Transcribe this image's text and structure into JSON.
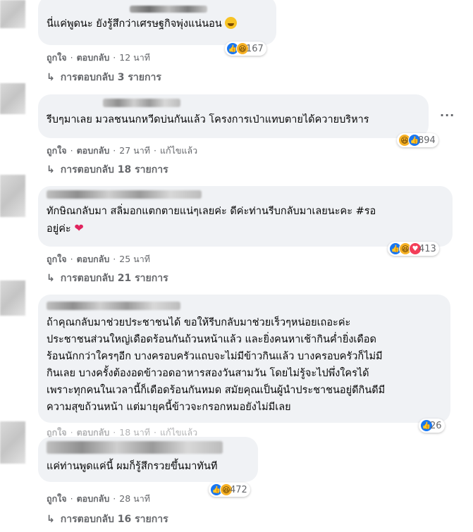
{
  "comments": [
    {
      "text": "นี่แค่พูดนะ ยังรู้สึกว่าเศรษฐกิจพุ่งแน่นอน",
      "like": "ถูกใจ",
      "reply": "ตอบกลับ",
      "time": "12 นาที",
      "edited": "",
      "reaction_count": "167",
      "reactions": [
        "like-icon",
        "haha-icon"
      ],
      "replies": "การตอบกลับ 3 รายการ"
    },
    {
      "text": "รีบๆมาเลย มวลชนนกหวีดบ่นกันแล้ว โครงการเป่าแทบตายได้ควายบริหาร",
      "like": "ถูกใจ",
      "reply": "ตอบกลับ",
      "time": "27 นาที",
      "edited": "แก้ไขแล้ว",
      "reaction_count": "894",
      "reactions": [
        "haha-icon",
        "like-icon"
      ],
      "replies": "การตอบกลับ 18 รายการ"
    },
    {
      "text_line1": "ทักษิณกลับมา สลิ่มอกแตกตายแน่ๆเลยค่ะ ดีค่ะท่านรีบกลับมาเลยนะคะ #รอ",
      "text_line2": "อยู่ค่ะ",
      "like": "ถูกใจ",
      "reply": "ตอบกลับ",
      "time": "25 นาที",
      "reaction_count": "413",
      "reactions": [
        "like-icon",
        "haha-icon",
        "love-icon"
      ],
      "replies": "การตอบกลับ 21 รายการ"
    },
    {
      "lines": [
        "ถ้าคุณกลับมาช่วยประชาชนได้ ขอให้รีบกลับมาช่วยเร็วๆหน่อยเถอะค่ะ",
        "ประชาชนส่วนใหญ่เดือดร้อนกันถ้วนหน้าแล้ว และยิ่งคนหาเช้ากินค่ำยิ่งเดือด",
        "ร้อนนักกว่าใครๆอีก บางครอบครัวแถบจะไม่มีข้าวกินแล้ว บางครอบครัวก็ไม่มี",
        "กินเลย บางครั้งต้องอดข้าวอดอาหารสองวันสามวัน โดยไม่รู้จะไปพึ่งใครได้",
        "เพราะทุกคนในเวลานี้ก็เดือดร้อนกันหมด สมัยคุณเป็นผู้นำประชาชนอยู่ดีกินดีมี",
        "ความสุขถ้วนหน้า แต่มายุคนี้ข้าวจะกรอกหมอยังไม่มีเลย"
      ],
      "like": "ถูกใจ",
      "reply": "ตอบกลับ",
      "time": "18 นาที",
      "edited": "แก้ไขแล้ว",
      "reaction_count": "26",
      "reactions": [
        "like-icon"
      ]
    },
    {
      "text": "แค่ท่านพูดแค่นี้ ผมก็รู้สึกรวยขึ้นมาทันที",
      "like": "ถูกใจ",
      "reply": "ตอบกลับ",
      "time": "28 นาที",
      "reaction_count": "472",
      "reactions": [
        "like-icon",
        "haha-icon"
      ],
      "replies": "การตอบกลับ 16 รายการ"
    }
  ]
}
